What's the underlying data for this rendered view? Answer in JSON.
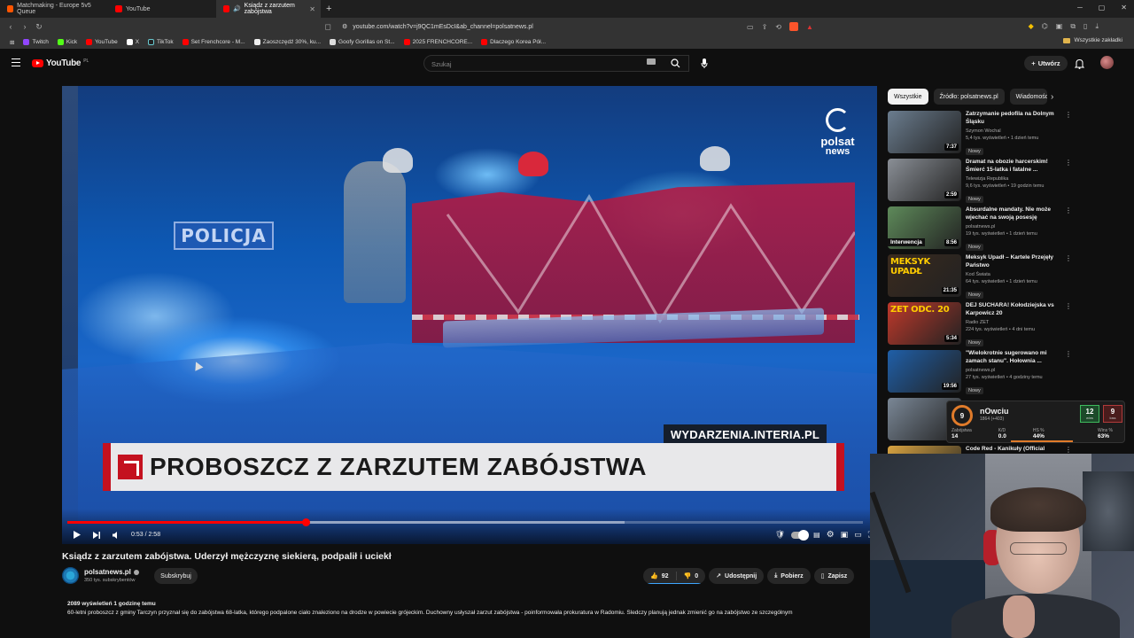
{
  "browser": {
    "tabs": [
      {
        "label": "Matchmaking - Europe 5v5 Queue",
        "active": false
      },
      {
        "label": "YouTube",
        "active": false
      },
      {
        "label": "Ksiądz z zarzutem zabójstwa",
        "active": true
      }
    ],
    "url": "youtube.com/watch?v=j9QC1mEsDcI&ab_channel=polsatnews.pl",
    "bookmarks": [
      "Twitch",
      "Kick",
      "YouTube",
      "X",
      "TikTok",
      "Set Frenchcore - M...",
      "Zaoszczędź 30%, ku...",
      "Goofy Gorillas on St...",
      "2025 FRENCHCORE...",
      "Dlaczego Korea Pół..."
    ],
    "all_bookmarks": "Wszystkie zakładki"
  },
  "youtube": {
    "logo_text": "YouTube",
    "logo_region": "PL",
    "search_placeholder": "Szukaj",
    "create_label": "Utwórz"
  },
  "player": {
    "overlay_brand_line1": "polsat",
    "overlay_brand_line2": "news",
    "police_sign": "POLICJA",
    "source_tag": "WYDARZENIA.INTERIA.PL",
    "headline": "PROBOSZCZ Z ZARZUTEM ZABÓJSTWA",
    "time": "0:53 / 2:58",
    "played_fraction": 0.3,
    "buffered_fraction": 0.7
  },
  "video": {
    "title": "Ksiądz z zarzutem zabójstwa. Uderzył mężczyznę siekierą, podpalił i uciekł",
    "channel": "polsatnews.pl",
    "subscribers": "350 tys. subskrybentów",
    "subscribe_label": "Subskrybuj",
    "likes": "92",
    "dislikes": "0",
    "share_label": "Udostępnij",
    "download_label": "Pobierz",
    "save_label": "Zapisz",
    "views_meta": "2089 wyświetleń  1 godzinę temu",
    "description": "60-letni proboszcz z gminy Tarczyn przyznał się do zabójstwa 68-latka, którego podpalone ciało znaleziono na drodze w powiecie grójeckim. Duchowny usłyszał zarzut zabójstwa - poinformowała prokuratura w Radomiu. Śledczy planują jednak zmienić go na zabójstwo ze szczególnym"
  },
  "chips": [
    "Wszystkie",
    "Źródło: polsatnews.pl",
    "Wiadomości"
  ],
  "recommendations": [
    {
      "title": "Zatrzymanie pedofila na Dolnym Śląsku",
      "channel": "Szymon Wochal",
      "views": "5,4 tys. wyświetleń • 1 dzień temu",
      "badge": "Nowy",
      "duration": "7:37",
      "color": "#6b7d8f"
    },
    {
      "title": "Dramat na obozie harcerskim! Śmierć 15-latka i fatalne ...",
      "channel": "Telewizja Republika",
      "views": "9,6 tys. wyświetleń • 19 godzin temu",
      "badge": "Nowy",
      "duration": "2:59",
      "color": "#8a8f96"
    },
    {
      "title": "Absurdalne mandaty. Nie może wjechać na swoją posesję",
      "channel": "polsatnews.pl",
      "views": "19 tys. wyświetleń • 1 dzień temu",
      "badge": "Nowy",
      "duration": "8:56",
      "color": "#5e8a5a",
      "label": "Interwencja"
    },
    {
      "title": "Meksyk Upadł – Kartele Przejęły Państwo",
      "channel": "Kod Świata",
      "views": "64 tys. wyświetleń • 1 dzień temu",
      "badge": "Nowy",
      "duration": "21:35",
      "color": "#3a2a1e",
      "big": "MEKSYK UPADŁ"
    },
    {
      "title": "DEJ SUCHARA! Kołodziejska vs Karpowicz 20",
      "channel": "Radio ZET",
      "views": "224 tys. wyświetleń • 4 dni temu",
      "badge": "Nowy",
      "duration": "5:34",
      "color": "#c0392b",
      "big": "ZET ODC. 20"
    },
    {
      "title": "\"Wielokrotnie sugerowano mi zamach stanu\". Hołownia ...",
      "channel": "polsatnews.pl",
      "views": "27 tys. wyświetleń • 4 godziny temu",
      "badge": "Nowy",
      "duration": "19:56",
      "color": "#1f5fa8"
    },
    {
      "title": "",
      "channel": "",
      "views": "",
      "badge": "",
      "duration": "",
      "color": "#7a8796"
    },
    {
      "title": "Code Red - Kanikuły (Official",
      "channel": "",
      "views": "",
      "badge": "",
      "duration": "",
      "color": "#d9a441"
    }
  ],
  "faceit_overlay": {
    "level": "9",
    "nickname": "nOwciu",
    "elo": "1864 (+403)",
    "stats": [
      {
        "label": "Zabójstwa",
        "value": "14"
      },
      {
        "label": "K/D",
        "value": "0.0"
      },
      {
        "label": "HS %",
        "value": "44%"
      }
    ],
    "wins": "12",
    "wins_label": "wins",
    "losses": "9",
    "losses_label": "loss",
    "winrate_label": "Wins %",
    "winrate": "63%"
  }
}
